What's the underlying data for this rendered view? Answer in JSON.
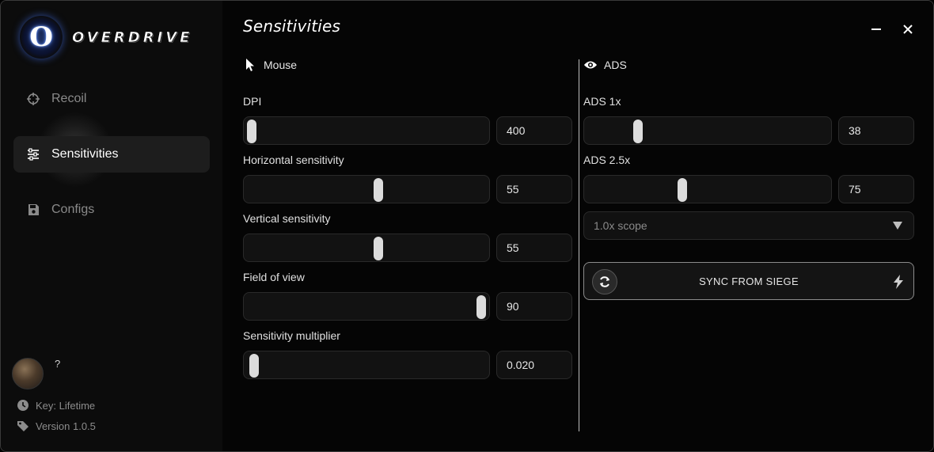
{
  "app": {
    "brand": "OVERDRIVE",
    "logo_letter": "O"
  },
  "sidebar": {
    "items": [
      {
        "label": "Recoil",
        "icon": "crosshair-icon",
        "active": false
      },
      {
        "label": "Sensitivities",
        "icon": "sliders-icon",
        "active": true
      },
      {
        "label": "Configs",
        "icon": "save-icon",
        "active": false
      }
    ]
  },
  "user": {
    "name": "?",
    "key_label": "Key: Lifetime",
    "version_label": "Version 1.0.5"
  },
  "page": {
    "title": "Sensitivities"
  },
  "mouse": {
    "heading": "Mouse",
    "fields": [
      {
        "label": "DPI",
        "value": "400",
        "level": 0.0
      },
      {
        "label": "Horizontal sensitivity",
        "value": "55",
        "level": 0.55
      },
      {
        "label": "Vertical sensitivity",
        "value": "55",
        "level": 0.55
      },
      {
        "label": "Field of view",
        "value": "90",
        "level": 1.0
      },
      {
        "label": "Sensitivity multiplier",
        "value": "0.020",
        "level": 0.01
      }
    ]
  },
  "ads": {
    "heading": "ADS",
    "fields": [
      {
        "label": "ADS 1x",
        "value": "38",
        "level": 0.2
      },
      {
        "label": "ADS 2.5x",
        "value": "75",
        "level": 0.39
      }
    ],
    "scope_select": {
      "selected": "1.0x scope"
    },
    "sync_button": {
      "label": "SYNC FROM SIEGE"
    }
  },
  "colors": {
    "accent": "#dcdcdc",
    "window_bg": "#050505",
    "sidebar_bg": "#0c0c0c"
  }
}
